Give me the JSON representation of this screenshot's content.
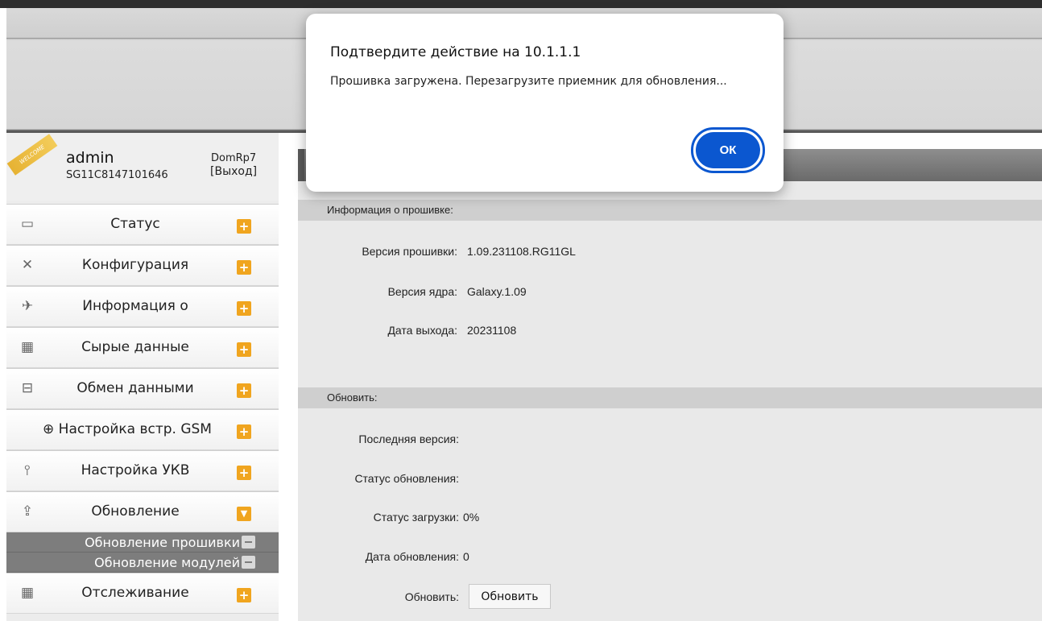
{
  "dialog": {
    "title": "Подтвердите действие на 10.1.1.1",
    "message": "Прошивка загружена. Перезагрузите приемник для обновления...",
    "ok_label": "ОК"
  },
  "user": {
    "ribbon": "WELCOME",
    "name": "admin",
    "serial": "SG11C8147101646",
    "station": "DomRp7",
    "logout": "[Выход]"
  },
  "menu": [
    {
      "label": "Статус",
      "icon": "monitor-icon",
      "glyph": "▭"
    },
    {
      "label": "Конфигурация",
      "icon": "tools-icon",
      "glyph": "✕"
    },
    {
      "label": "Информация о",
      "icon": "satellite-icon",
      "glyph": "✈"
    },
    {
      "label": "Сырые данные",
      "icon": "calendar-chart-icon",
      "glyph": "▦"
    },
    {
      "label": "Обмен данными",
      "icon": "network-icon",
      "glyph": "⊟"
    },
    {
      "label": "⊕ Настройка встр. GSM",
      "icon": "globe-icon",
      "glyph": ""
    },
    {
      "label": "Настройка УКВ",
      "icon": "antenna-icon",
      "glyph": "⫯"
    },
    {
      "label": "Обновление",
      "icon": "upload-icon",
      "glyph": "⇪"
    },
    {
      "label": "Отслеживание",
      "icon": "calendar-chart-icon",
      "glyph": "▦"
    }
  ],
  "submenu": [
    {
      "label": "Обновление прошивки"
    },
    {
      "label": "Обновление модулей"
    }
  ],
  "firmware_info": {
    "heading": "Информация о прошивке:",
    "version_label": "Версия прошивки:",
    "version_value": "1.09.231108.RG11GL",
    "kernel_label": "Версия ядра:",
    "kernel_value": "Galaxy.1.09",
    "release_label": "Дата выхода:",
    "release_value": "20231108"
  },
  "update": {
    "heading": "Обновить:",
    "latest_label": "Последняя версия:",
    "status_label": "Статус обновления:",
    "download_label": "Статус загрузки:",
    "download_value": "0%",
    "date_label": "Дата обновления:",
    "date_value": "0",
    "update_label": "Обновить:",
    "update_button": "Обновить"
  },
  "colors": {
    "accent_orange": "#f0a51f",
    "ok_blue": "#0b57d0",
    "submenu_gray": "#7d7d7d"
  }
}
